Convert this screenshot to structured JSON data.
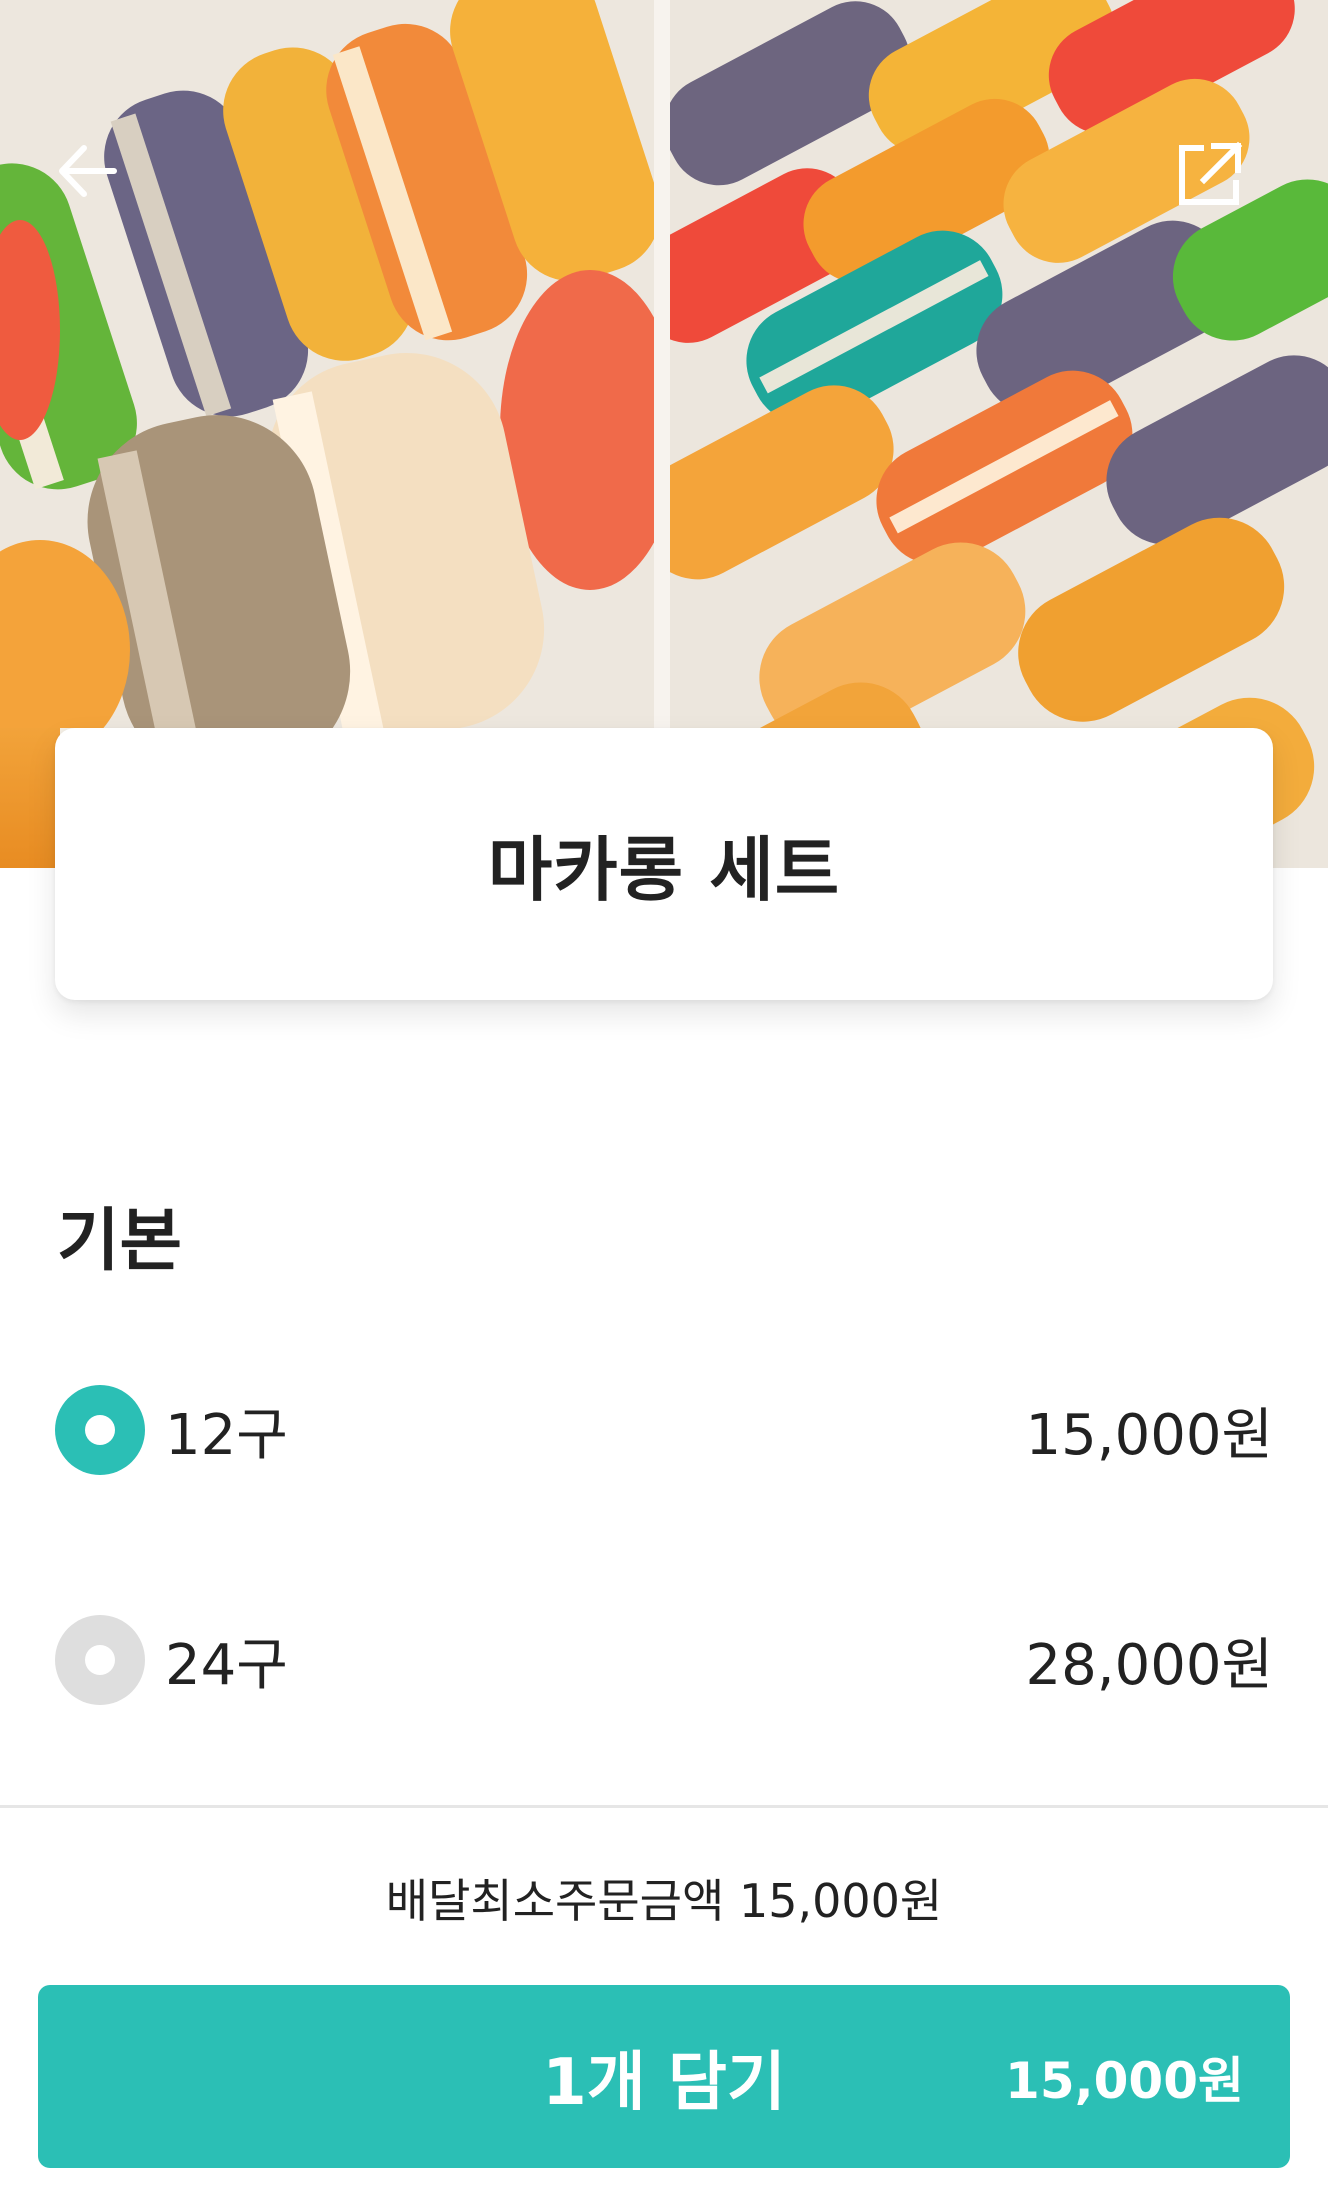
{
  "product": {
    "name": "마카롱 세트",
    "image_alt": "macaron photos"
  },
  "options": {
    "section_title": "기본",
    "items": [
      {
        "label": "12구",
        "price": "15,000원",
        "selected": true
      },
      {
        "label": "24구",
        "price": "28,000원",
        "selected": false
      }
    ]
  },
  "footer": {
    "min_order_text": "배달최소주문금액 15,000원",
    "cart_button_label": "1개 담기",
    "cart_button_price": "15,000원"
  },
  "icons": {
    "back": "back-arrow-icon",
    "share": "share-icon"
  },
  "colors": {
    "accent": "#2bbfb5",
    "radio_off": "#dedede",
    "text": "#222222"
  }
}
